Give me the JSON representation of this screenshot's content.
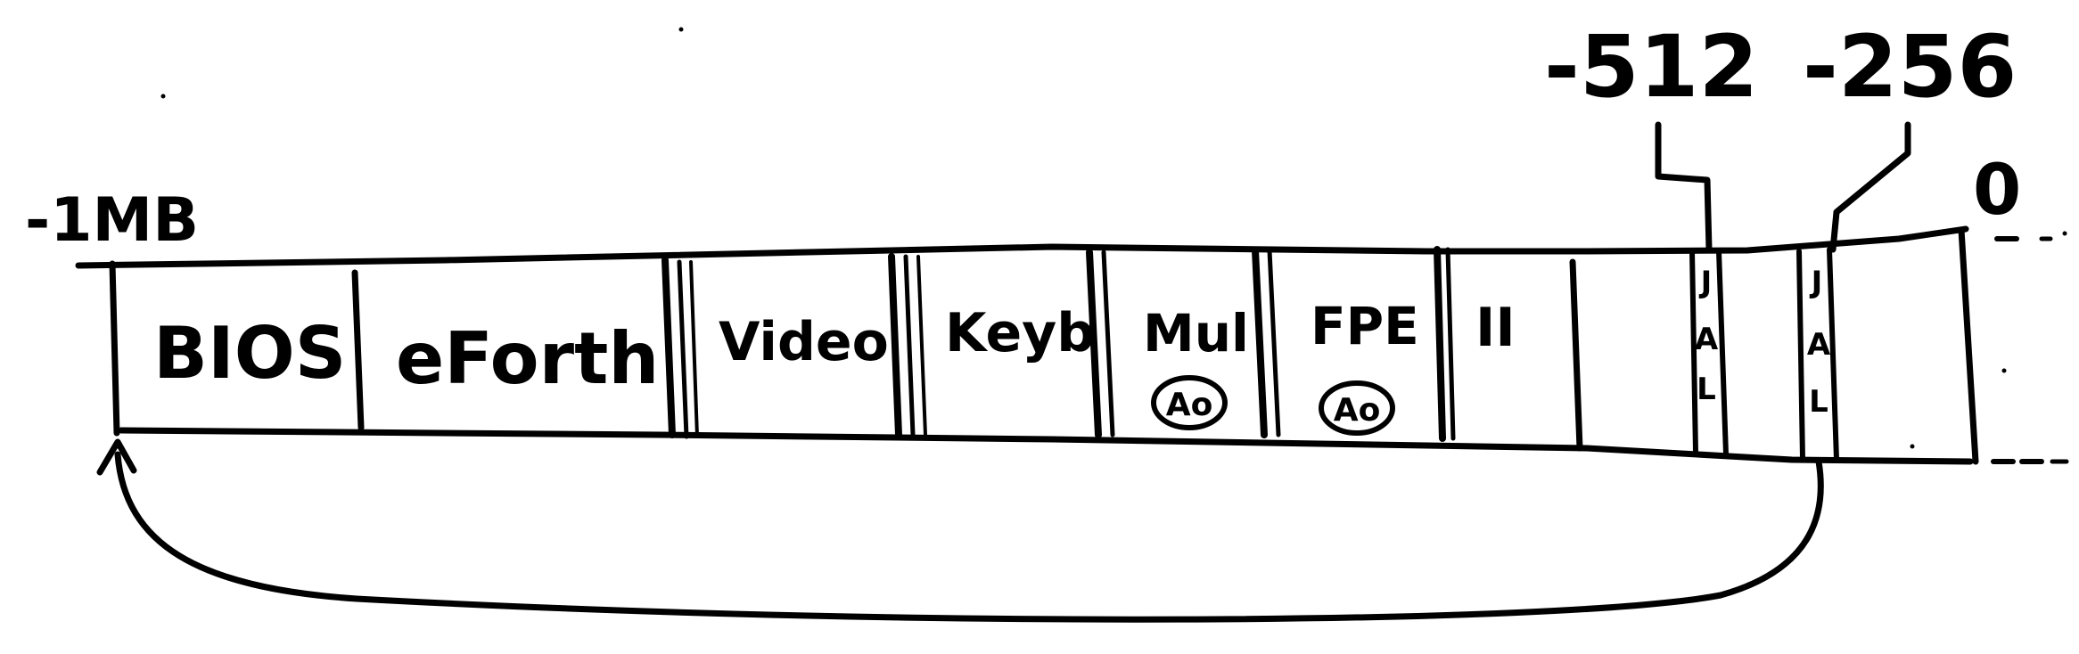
{
  "diagram": {
    "start_label": "-1MB",
    "end_label": "0",
    "markers": {
      "m512": "-512",
      "m256": "-256"
    },
    "blocks": {
      "bios": "BIOS",
      "eforth": "eForth",
      "video": "Video",
      "keyb": "Keyb",
      "mul": "Mul",
      "fpe": "FPE",
      "ii": "II"
    },
    "badges": {
      "mul": "Ao",
      "fpe": "Ao"
    },
    "jal_letters": [
      "J",
      "A",
      "L"
    ]
  },
  "style": {
    "ink": "#000000",
    "paper": "#ffffff"
  }
}
